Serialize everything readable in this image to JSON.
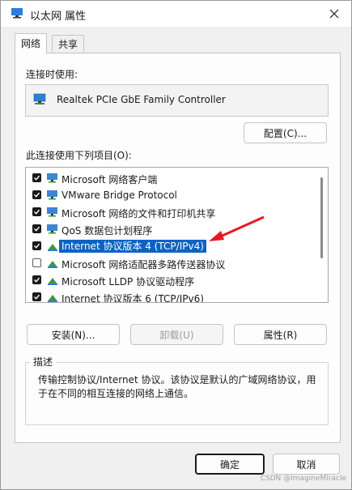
{
  "window": {
    "title": "以太网 属性"
  },
  "tabs": [
    {
      "label": "网络"
    },
    {
      "label": "共享"
    }
  ],
  "connect_using": {
    "label": "连接时使用:",
    "adapter": "Realtek PCIe GbE Family Controller",
    "configure_button": "配置(C)..."
  },
  "items_section": {
    "label": "此连接使用下列项目(O):"
  },
  "items": [
    {
      "label": "Microsoft 网络客户端",
      "checked": true,
      "icon": "network-client-icon"
    },
    {
      "label": "VMware Bridge Protocol",
      "checked": true,
      "icon": "network-client-icon"
    },
    {
      "label": "Microsoft 网络的文件和打印机共享",
      "checked": true,
      "icon": "network-client-icon"
    },
    {
      "label": "QoS 数据包计划程序",
      "checked": true,
      "icon": "network-client-icon"
    },
    {
      "label": "Internet 协议版本 4 (TCP/IPv4)",
      "checked": true,
      "icon": "protocol-icon",
      "selected": true
    },
    {
      "label": "Microsoft 网络适配器多路传送器协议",
      "checked": false,
      "icon": "protocol-icon"
    },
    {
      "label": "Microsoft LLDP 协议驱动程序",
      "checked": true,
      "icon": "protocol-icon"
    },
    {
      "label": "Internet 协议版本 6 (TCP/IPv6)",
      "checked": true,
      "icon": "protocol-icon"
    }
  ],
  "actions": {
    "install": "安装(N)...",
    "uninstall": "卸载(U)",
    "properties": "属性(R)"
  },
  "description": {
    "title": "描述",
    "text": "传输控制协议/Internet 协议。该协议是默认的广域网络协议，用于在不同的相互连接的网络上通信。"
  },
  "footer": {
    "ok": "确定",
    "cancel": "取消"
  },
  "watermark": "CSDN @ImagineMiracle",
  "colors": {
    "selection": "#0b63c4",
    "annotation_arrow": "#e8191b"
  }
}
